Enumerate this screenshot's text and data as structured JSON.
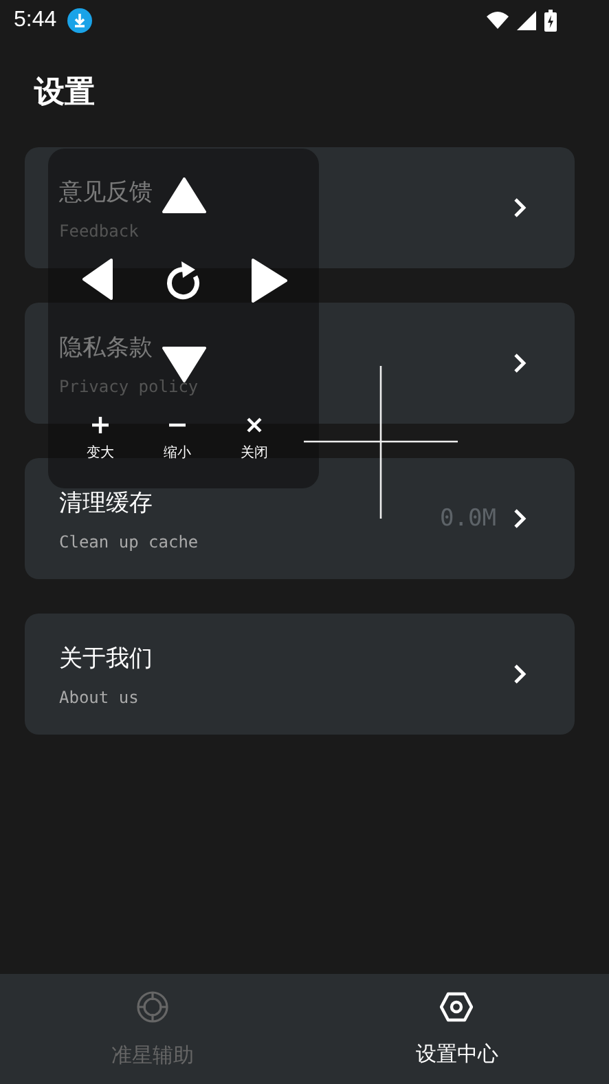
{
  "status_bar": {
    "time": "5:44"
  },
  "title": "设置",
  "items": [
    {
      "title": "意见反馈",
      "subtitle": "Feedback"
    },
    {
      "title": "隐私条款",
      "subtitle": "Privacy policy"
    },
    {
      "title": "清理缓存",
      "subtitle": "Clean up cache",
      "value": "0.0M"
    },
    {
      "title": "关于我们",
      "subtitle": "About us"
    }
  ],
  "overlay": {
    "actions": [
      {
        "kind": "plus",
        "label": "变大"
      },
      {
        "kind": "minus",
        "label": "缩小"
      },
      {
        "kind": "close",
        "label": "关闭"
      }
    ]
  },
  "tabs": [
    {
      "kind": "crosshair",
      "label": "准星辅助",
      "selected": false
    },
    {
      "kind": "settings",
      "label": "设置中心",
      "selected": true
    }
  ]
}
